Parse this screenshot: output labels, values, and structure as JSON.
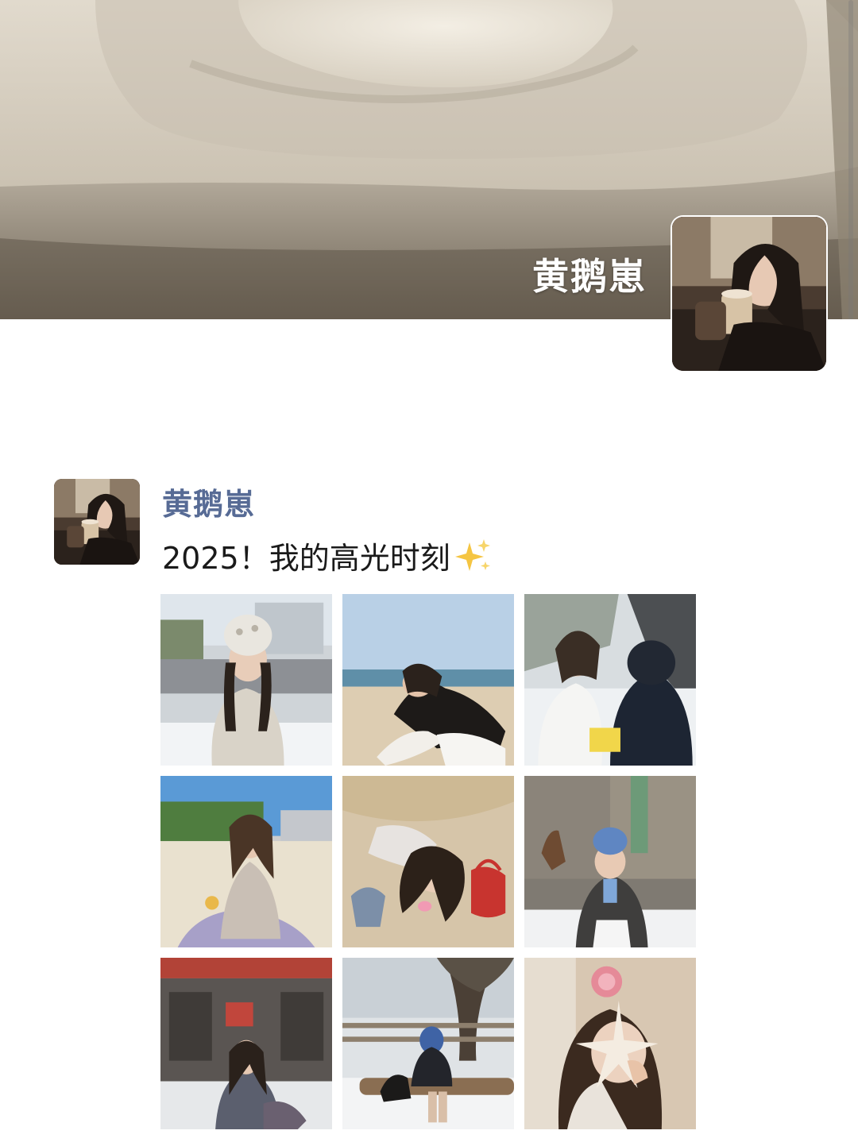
{
  "profile": {
    "name": "黄鹅崽"
  },
  "post": {
    "author": "黄鹅崽",
    "text": "2025！我的高光时刻",
    "emoji_icon": "sparkles-icon",
    "photos": [
      {
        "description": "woman in knit hat on snowy street"
      },
      {
        "description": "woman sitting on beach by sea"
      },
      {
        "description": "woman smiling on snowy path with friend"
      },
      {
        "description": "woman on tropical beach with drink"
      },
      {
        "description": "woman lying in sand with red bag"
      },
      {
        "description": "woman in blue hat with horse in snow"
      },
      {
        "description": "woman outside vintage and retro shop"
      },
      {
        "description": "woman sitting on log in snow with dog"
      },
      {
        "description": "woman holding starfish and flower"
      }
    ]
  },
  "colors": {
    "author_link": "#576b95",
    "text": "#1a1a1a",
    "background": "#ffffff"
  }
}
